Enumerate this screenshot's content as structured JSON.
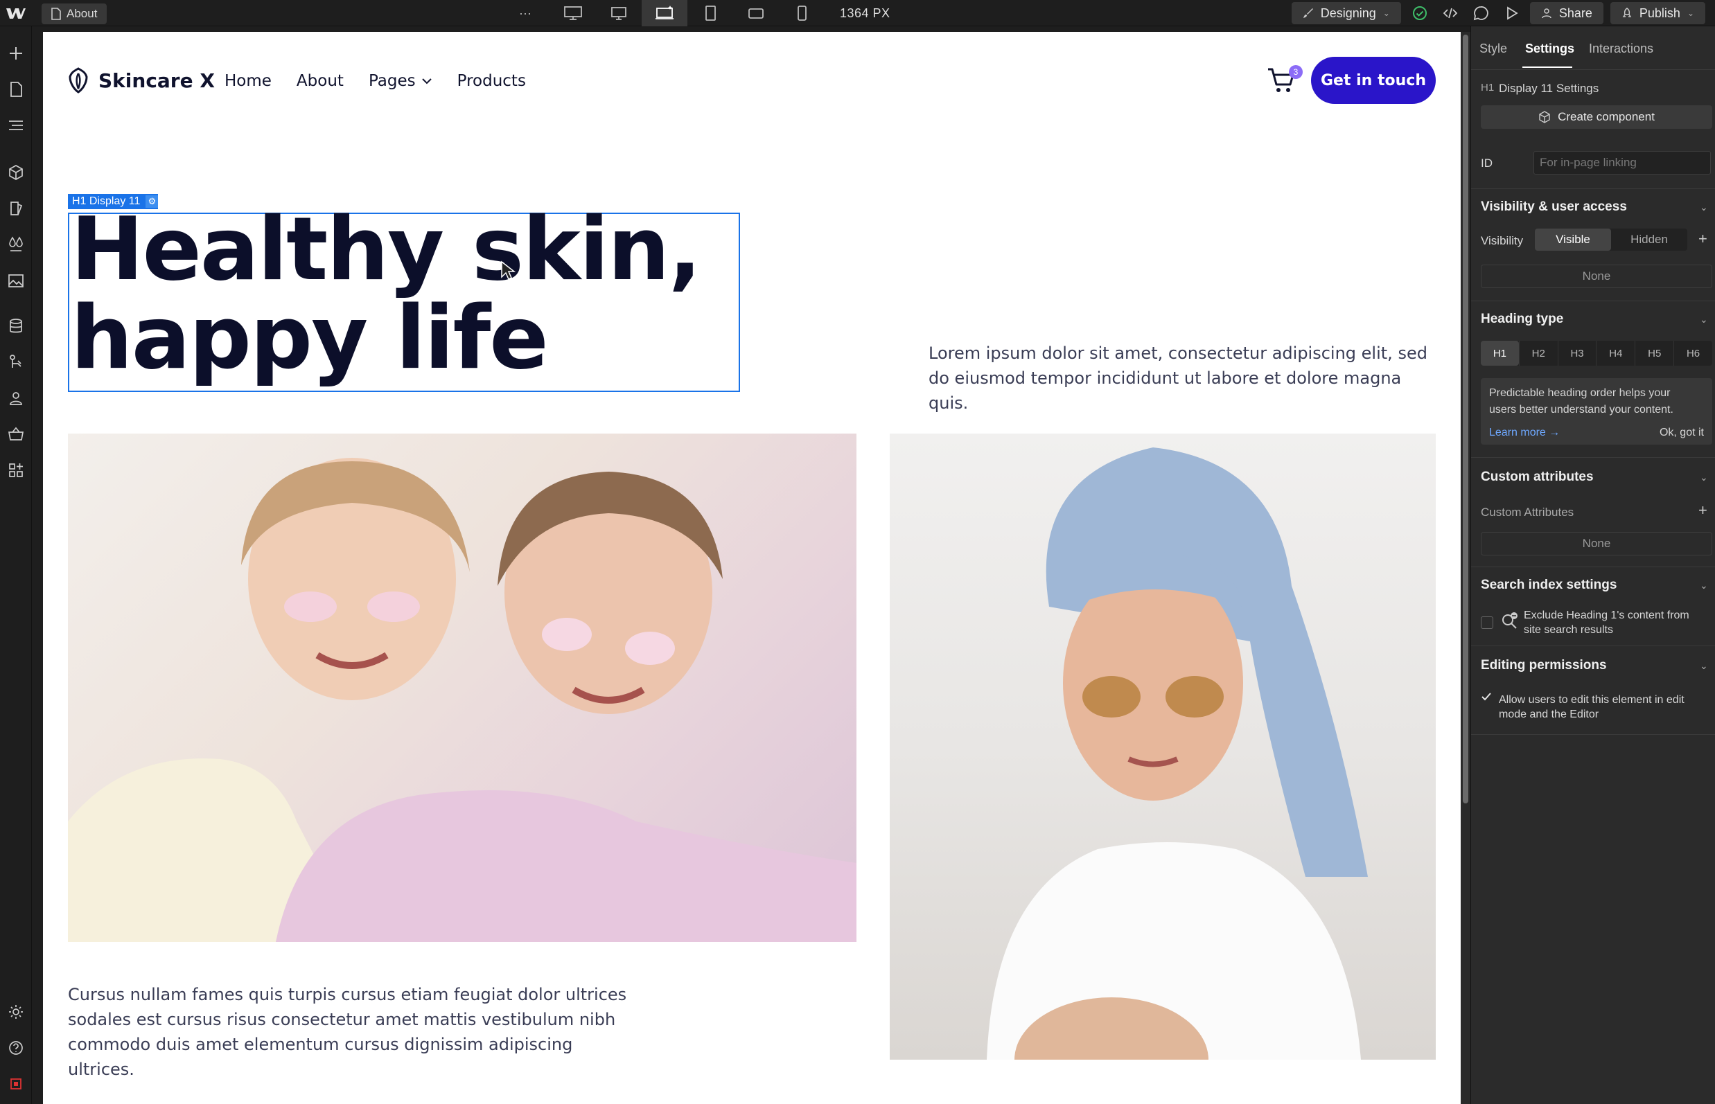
{
  "topbar": {
    "page_label": "About",
    "more": "···",
    "width_readout": "1364 PX",
    "mode_label": "Designing",
    "share_label": "Share",
    "publish_label": "Publish"
  },
  "site": {
    "brand": "Skincare X",
    "nav": [
      "Home",
      "About",
      "Pages",
      "Products"
    ],
    "cart_count": "3",
    "cta": "Get in touch",
    "selection_label": "H1 Display 11",
    "hero_line1": "Healthy skin,",
    "hero_line2": "happy life",
    "hero_paragraph": "Lorem ipsum dolor sit amet, consectetur adipiscing elit, sed do eiusmod tempor incididunt ut labore et dolore magna quis.",
    "bottom_paragraph": "Cursus nullam fames quis turpis cursus etiam feugiat dolor ultrices sodales est cursus risus consectetur amet mattis vestibulum nibh commodo duis amet elementum cursus dignissim adipiscing ultrices."
  },
  "panel": {
    "tabs": [
      "Style",
      "Settings",
      "Interactions"
    ],
    "element_title": "Display 11 Settings",
    "element_tag": "H1",
    "create_component": "Create component",
    "id_label": "ID",
    "id_placeholder": "For in-page linking",
    "visibility_section": "Visibility & user access",
    "visibility_label": "Visibility",
    "visible": "Visible",
    "hidden": "Hidden",
    "visibility_none": "None",
    "heading_section": "Heading type",
    "heading_levels": [
      "H1",
      "H2",
      "H3",
      "H4",
      "H5",
      "H6"
    ],
    "note_text": "Predictable heading order helps your users better understand your content.",
    "learn_more": "Learn more →",
    "ok_got_it": "Ok, got it",
    "custom_section": "Custom attributes",
    "custom_label": "Custom Attributes",
    "custom_none": "None",
    "search_section": "Search index settings",
    "search_text": "Exclude Heading 1's content from site search results",
    "editing_section": "Editing permissions",
    "editing_text": "Allow users to edit this element in edit mode and the Editor"
  },
  "colors": {
    "cta_bg": "#2a15c9",
    "selection": "#1a73e8",
    "badge": "#8c6cf7",
    "status_ok": "#3fbf6a"
  }
}
